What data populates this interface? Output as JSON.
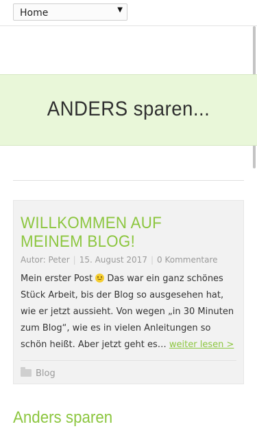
{
  "nav": {
    "selected": "Home"
  },
  "hero": {
    "title": "ANDERS sparen..."
  },
  "post": {
    "title": "WILLKOMMEN AUF MEINEM BLOG!",
    "author_label": "Autor: Peter",
    "date": "15. August 2017",
    "comments": "0 Kommentare",
    "excerpt_before": "Mein erster Post ",
    "excerpt_after": " Das war ein ganz schönes Stück Arbeit, bis der Blog so ausgesehen hat, wie er jetzt aussieht. Von wegen „in 30 Minuten zum Blog“, wie es in vielen Anleitungen so schön heißt. Aber jetzt geht es… ",
    "read_more": "weiter lesen >",
    "category": "Blog"
  },
  "sidebar": {
    "widget_title": "Anders sparen"
  },
  "colors": {
    "accent": "#8cc63f",
    "hero_bg": "#e9f7d9",
    "post_bg": "#f2f2f2"
  },
  "icons": {
    "smiley": "smiley-icon",
    "folder": "folder-icon",
    "dropdown": "chevron-down-icon"
  }
}
